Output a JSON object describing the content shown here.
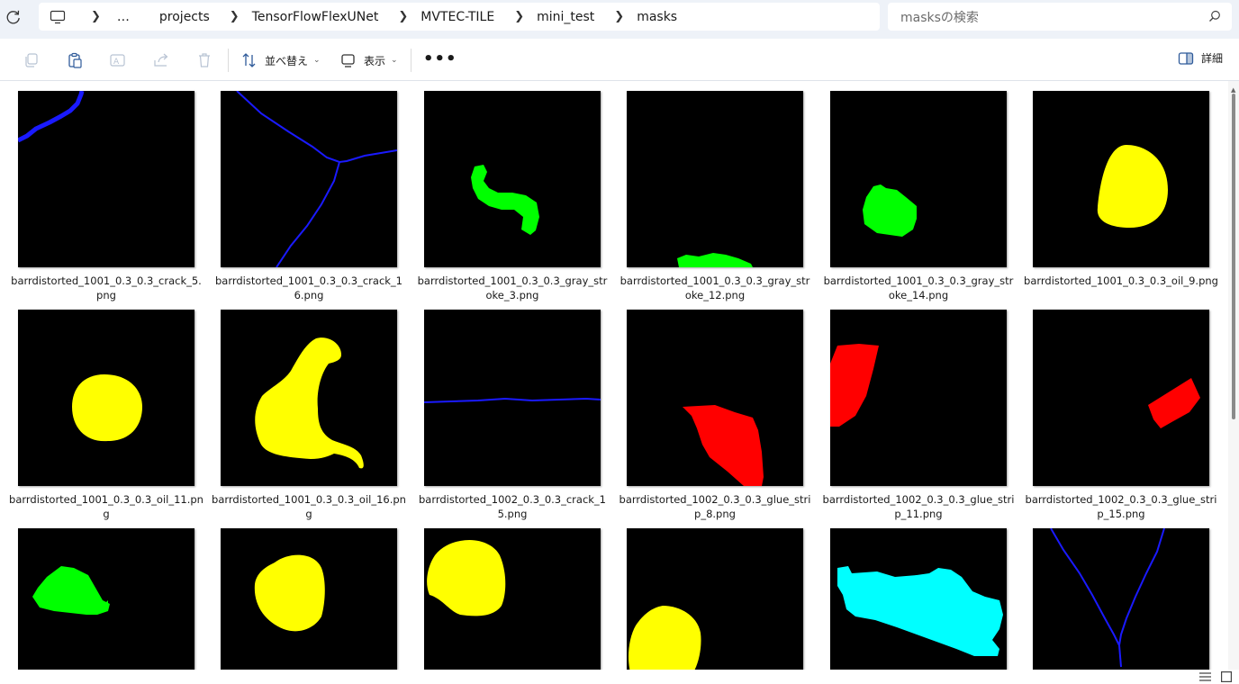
{
  "breadcrumb": {
    "overflow": "…",
    "items": [
      "projects",
      "TensorFlowFlexUNet",
      "MVTEC-TILE",
      "mini_test",
      "masks"
    ]
  },
  "search": {
    "placeholder": "masksの検索"
  },
  "toolbar": {
    "sort_label": "並べ替え",
    "view_label": "表示",
    "more_label": "•••",
    "details_label": "詳細"
  },
  "files": [
    {
      "name": "barrdistorted_1001_0.3_0.3_crack_5.png",
      "mask": "crack-corner"
    },
    {
      "name": "barrdistorted_1001_0.3_0.3_crack_16.png",
      "mask": "crack-y"
    },
    {
      "name": "barrdistorted_1001_0.3_0.3_gray_stroke_3.png",
      "mask": "stroke-s"
    },
    {
      "name": "barrdistorted_1001_0.3_0.3_gray_stroke_12.png",
      "mask": "stroke-bottom"
    },
    {
      "name": "barrdistorted_1001_0.3_0.3_gray_stroke_14.png",
      "mask": "stroke-blob"
    },
    {
      "name": "barrdistorted_1001_0.3_0.3_oil_9.png",
      "mask": "oil-egg"
    },
    {
      "name": "barrdistorted_1001_0.3_0.3_oil_11.png",
      "mask": "oil-round"
    },
    {
      "name": "barrdistorted_1001_0.3_0.3_oil_16.png",
      "mask": "oil-large"
    },
    {
      "name": "barrdistorted_1002_0.3_0.3_crack_15.png",
      "mask": "crack-horizontal"
    },
    {
      "name": "barrdistorted_1002_0.3_0.3_glue_strip_8.png",
      "mask": "glue-center"
    },
    {
      "name": "barrdistorted_1002_0.3_0.3_glue_strip_11.png",
      "mask": "glue-left"
    },
    {
      "name": "barrdistorted_1002_0.3_0.3_glue_strip_15.png",
      "mask": "glue-right"
    },
    {
      "name": "",
      "mask": "stroke-left"
    },
    {
      "name": "",
      "mask": "oil-center"
    },
    {
      "name": "",
      "mask": "oil-topleft"
    },
    {
      "name": "",
      "mask": "oil-bottomleft"
    },
    {
      "name": "",
      "mask": "cyan-region"
    },
    {
      "name": "",
      "mask": "crack-v"
    }
  ],
  "colors": {
    "crack": "#1a1aff",
    "gray_stroke": "#00ff00",
    "oil": "#ffff00",
    "glue_strip": "#ff0000",
    "cyan": "#00ffff",
    "address_bar_bg": "#eef2f8"
  },
  "icons": {
    "refresh": "refresh-icon",
    "pc": "pc-icon",
    "search": "search-icon",
    "copy": "copy-icon",
    "paste": "paste-icon",
    "rename": "rename-icon",
    "share": "share-icon",
    "delete": "delete-icon",
    "sort": "sort-icon",
    "view": "view-icon",
    "details": "details-pane-icon"
  }
}
